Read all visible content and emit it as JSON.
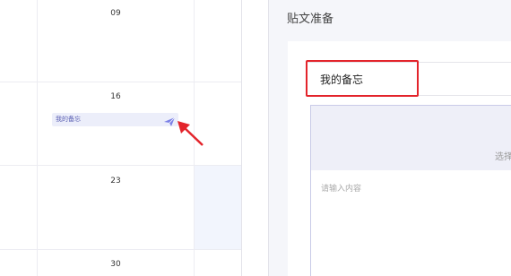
{
  "calendar": {
    "days": [
      "09",
      "16",
      "23",
      "30"
    ],
    "event": {
      "label": "我的备忘",
      "icon": "send-icon"
    }
  },
  "editor": {
    "title": "贴文准备",
    "title_input_value": "我的备忘",
    "upload_text": "选择",
    "content_placeholder": "请输入内容"
  },
  "colors": {
    "accent": "#7b80e6",
    "highlight": "#e3242b",
    "chip_bg": "#eceefa"
  }
}
